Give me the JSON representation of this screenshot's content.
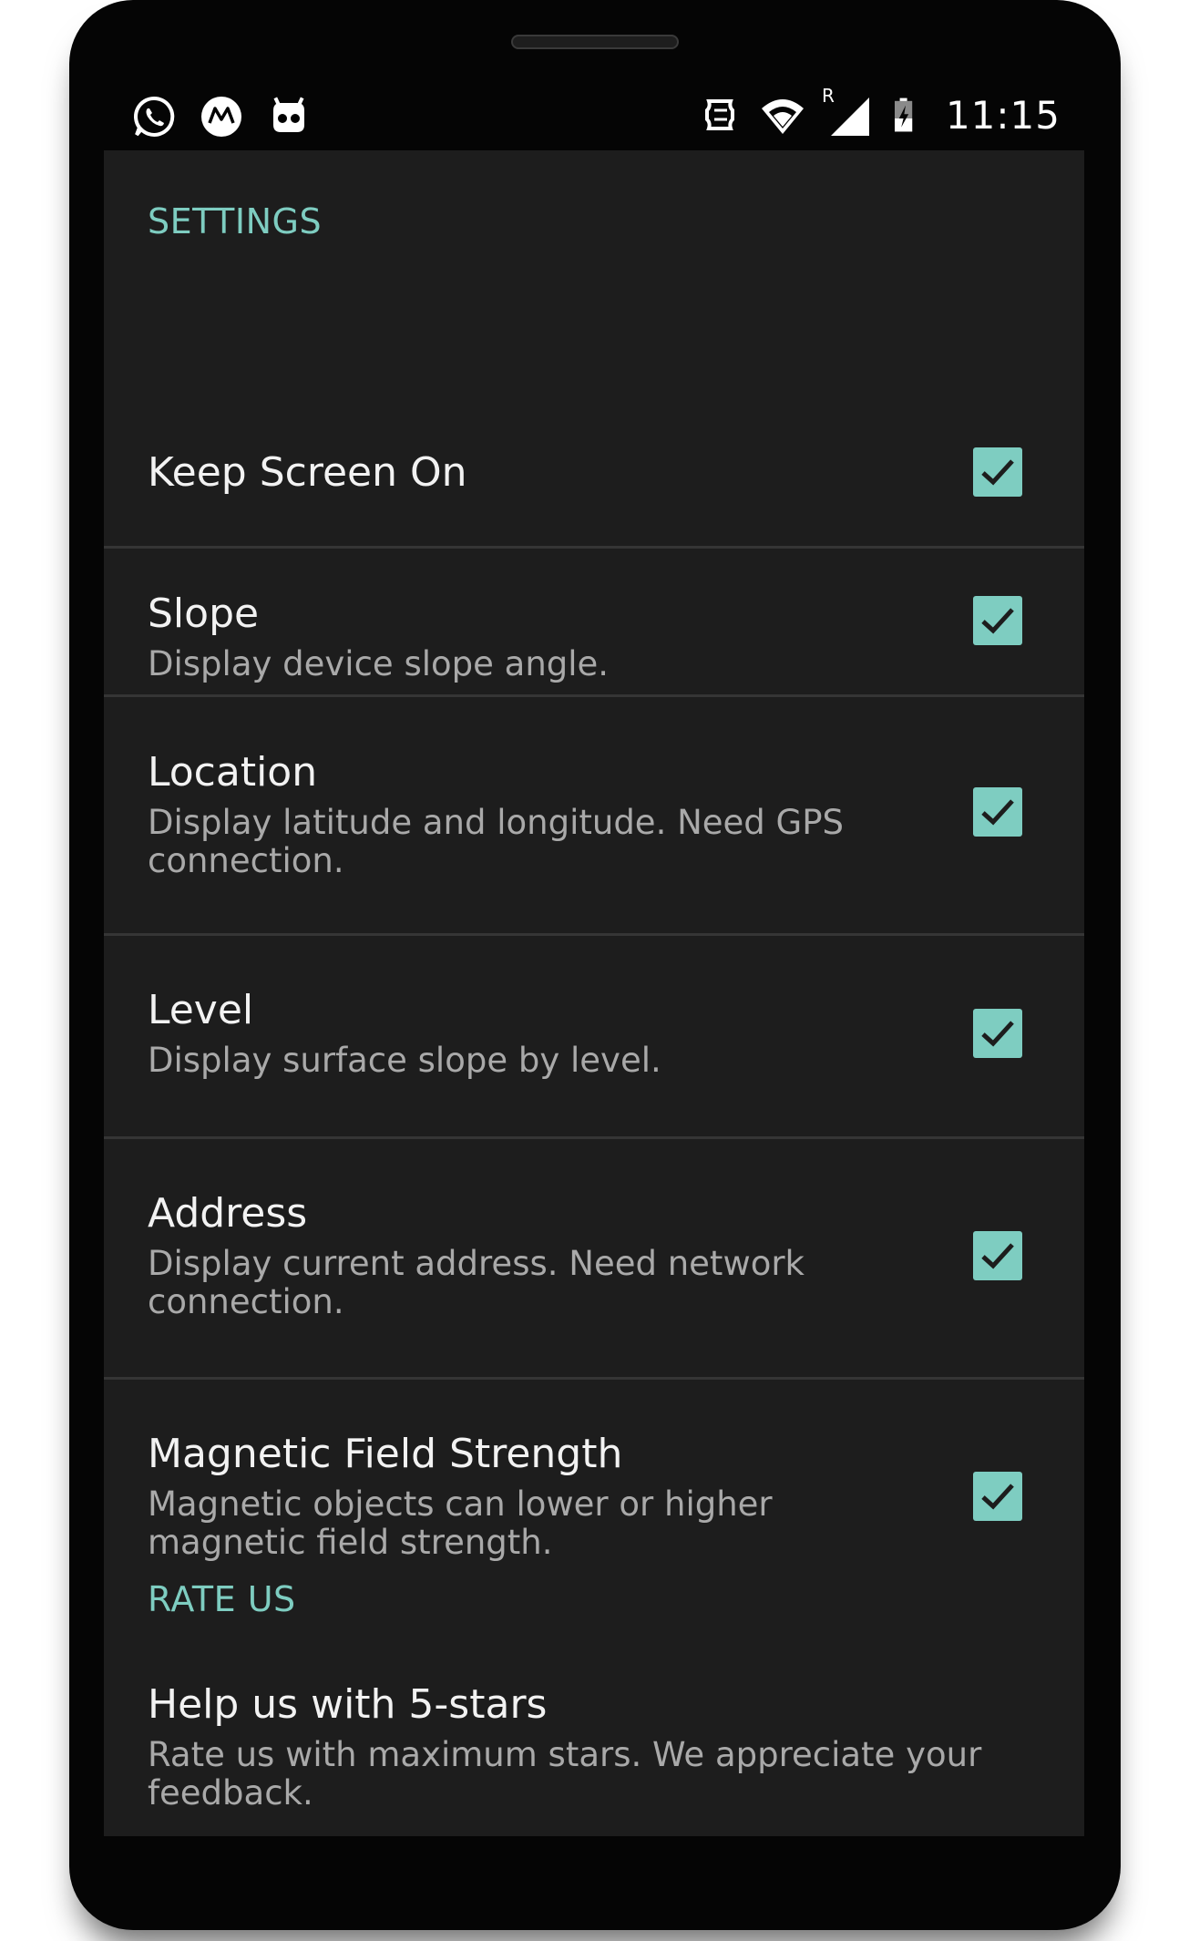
{
  "status_bar": {
    "left_icons": [
      "whatsapp-icon",
      "motorola-icon",
      "cyanogenmod-icon"
    ],
    "right_icons": [
      "sync-icon",
      "wifi-icon",
      "cell-signal-icon",
      "battery-icon"
    ],
    "roaming_indicator": "R",
    "time": "11:15"
  },
  "colors": {
    "accent": "#7ecdc1",
    "background": "#1d1d1d",
    "divider": "#353535"
  },
  "settings": {
    "header": "SETTINGS",
    "items": [
      {
        "title": "Keep Screen On",
        "summary": "",
        "checked": true
      },
      {
        "title": "Slope",
        "summary": "Display device slope angle.",
        "checked": true
      },
      {
        "title": "Location",
        "summary": "Display latitude and longitude. Need GPS connection.",
        "checked": true
      },
      {
        "title": "Level",
        "summary": "Display surface slope by level.",
        "checked": true
      },
      {
        "title": "Address",
        "summary": "Display current address. Need network connection.",
        "checked": true
      },
      {
        "title": "Magnetic Field Strength",
        "summary": "Magnetic objects can lower or higher magnetic field strength.",
        "checked": true
      }
    ]
  },
  "rate_us": {
    "header": "RATE US",
    "item": {
      "title": "Help us with 5-stars",
      "summary": "Rate us with maximum stars. We appreciate your feedback."
    }
  }
}
